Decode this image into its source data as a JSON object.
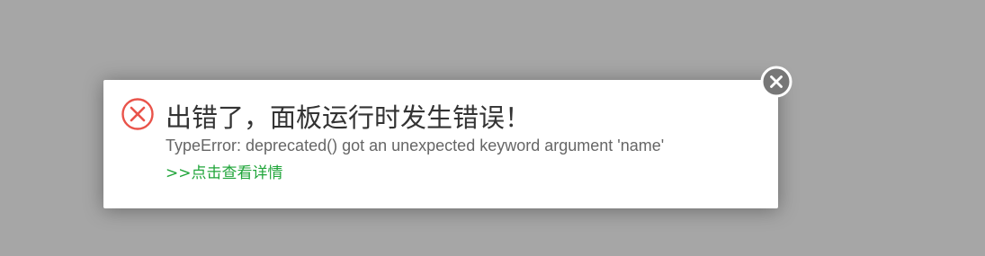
{
  "dialog": {
    "title": "出错了，面板运行时发生错误！",
    "message": "TypeError: deprecated() got an unexpected keyword argument 'name'",
    "details_link": ">>点击查看详情",
    "icons": {
      "status": "error-circle-x-icon",
      "close": "close-icon"
    }
  },
  "colors": {
    "overlay": "#a6a6a6",
    "error_red": "#e9534a",
    "link_green": "#20a53a",
    "title_text": "#333333",
    "message_text": "#666666",
    "close_button": "#777777"
  }
}
